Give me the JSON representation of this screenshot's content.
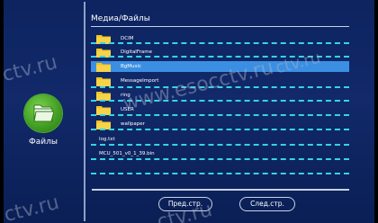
{
  "sidebar": {
    "app_label": "Файлы",
    "icon": "folder-icon"
  },
  "header": {
    "title": "Медиа/Файлы"
  },
  "files": [
    {
      "name": "DCIM",
      "type": "folder",
      "selected": false
    },
    {
      "name": "DigitalFrame",
      "type": "folder",
      "selected": false
    },
    {
      "name": "BgMusic",
      "type": "folder",
      "selected": true
    },
    {
      "name": "MessageImport",
      "type": "folder",
      "selected": false
    },
    {
      "name": "ring",
      "type": "folder",
      "selected": false
    },
    {
      "name": "USER",
      "type": "folder",
      "selected": false
    },
    {
      "name": "wallpaper",
      "type": "folder",
      "selected": false
    },
    {
      "name": "log.txt",
      "type": "file",
      "selected": false
    },
    {
      "name": "MCU_501_v0_1_39.bin",
      "type": "file",
      "selected": false
    }
  ],
  "buttons": {
    "prev": "Пред.стр.",
    "next": "След.стр."
  },
  "watermarks": {
    "text_short": "ctv.ru",
    "text_long": "www.esocctv.ru"
  },
  "colors": {
    "background": "#12296a",
    "selected_row": "#3b8fe3",
    "dash_lines": "#37d4e0",
    "folder": "#f5c518",
    "app_icon": "#3f9b22"
  }
}
